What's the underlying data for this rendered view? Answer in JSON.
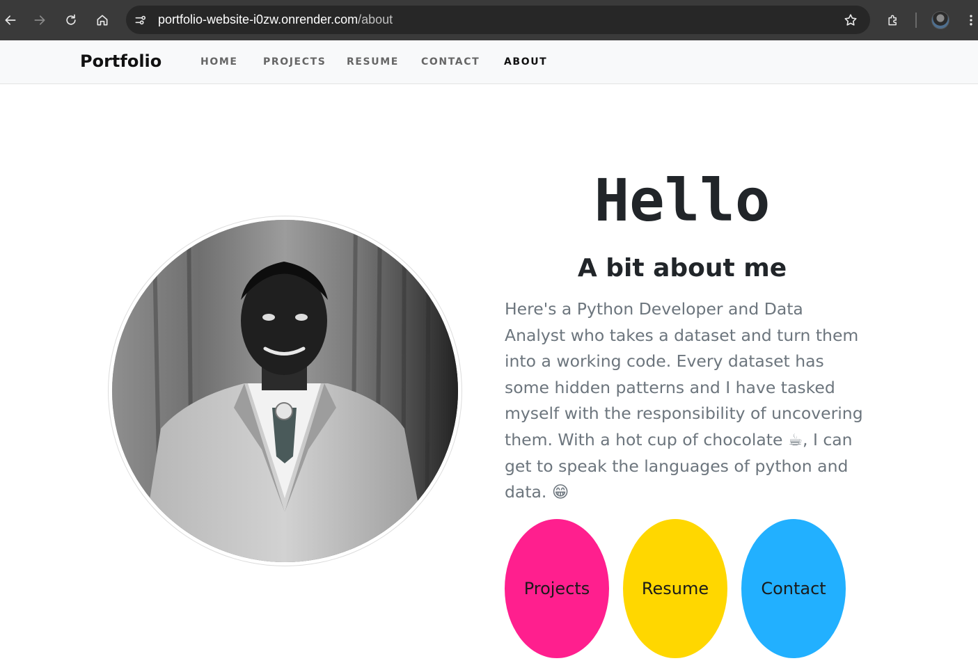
{
  "browser": {
    "url_host": "portfolio-website-i0zw.onrender.com",
    "url_path": "/about"
  },
  "navbar": {
    "brand": "Portfolio",
    "links": [
      {
        "label": "HOME",
        "active": false
      },
      {
        "label": "PROJECTS",
        "active": false
      },
      {
        "label": "RESUME",
        "active": false
      },
      {
        "label": "CONTACT",
        "active": false
      },
      {
        "label": "ABOUT",
        "active": true
      }
    ]
  },
  "about": {
    "heading": "Hello",
    "subheading": "A bit about me",
    "bio_part1": "Here's a Python Developer and Data Analyst who takes a dataset and turn them into a working code. Every dataset has some hidden patterns and I have tasked myself with the responsibility of uncovering them. With a hot cup of chocolate ",
    "emoji_cup": "☕",
    "bio_part2": ", I can get to speak the languages of python and data. ",
    "emoji_grin": "😁"
  },
  "buttons": {
    "projects": {
      "label": "Projects",
      "color": "#ff1f8e"
    },
    "resume": {
      "label": "Resume",
      "color": "#ffd700"
    },
    "contact": {
      "label": "Contact",
      "color": "#22b0ff"
    }
  },
  "icons": {
    "back": "arrow-left-icon",
    "forward": "arrow-right-icon",
    "reload": "reload-icon",
    "home": "home-icon",
    "site_info": "tune-icon",
    "bookmark": "star-icon",
    "extensions": "puzzle-icon",
    "menu": "more-vert-icon"
  }
}
